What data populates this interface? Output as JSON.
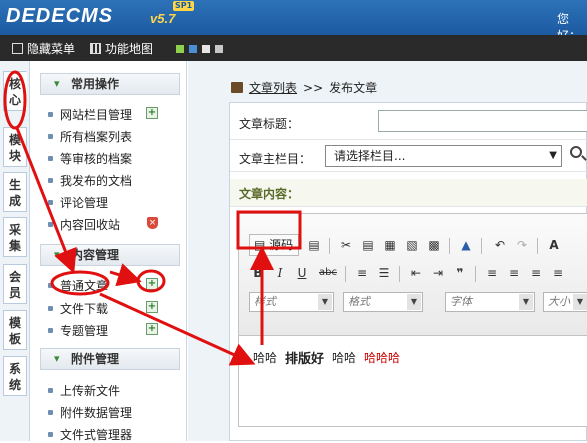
{
  "header": {
    "logo": "DEDECMS",
    "version": "v5.7",
    "version_tag": "SP1",
    "greeting": "您好："
  },
  "menubar": {
    "hide_menu": "隐藏菜单",
    "function_map": "功能地图",
    "skin_colors": [
      "#8fd14f",
      "#4a8fd6",
      "#e6e6e6",
      "#d8d8d8"
    ]
  },
  "left_tabs": [
    "核心",
    "模块",
    "生成",
    "采集",
    "会员",
    "模板",
    "系统"
  ],
  "sidebar": {
    "sections": [
      {
        "title": "常用操作",
        "items": [
          "网站栏目管理",
          "所有档案列表",
          "等审核的档案",
          "我发布的文档",
          "评论管理",
          "内容回收站"
        ]
      },
      {
        "title": "内容管理",
        "items": [
          "普通文章",
          "文件下载",
          "专题管理"
        ]
      },
      {
        "title": "附件管理",
        "items": [
          "上传新文件",
          "附件数据管理",
          "文件式管理器"
        ]
      }
    ]
  },
  "breadcrumb": {
    "link": "文章列表",
    "separator": ">>",
    "current": "发布文章"
  },
  "form": {
    "title_label": "文章标题：",
    "column_label": "文章主栏目：",
    "column_select": "请选择栏目...",
    "content_label": "文章内容："
  },
  "editor": {
    "source_button": "源码",
    "toolbar_row1": [
      "✂",
      "▤",
      "▦",
      "▧",
      "▩",
      "▲",
      "↶",
      "↷",
      "A"
    ],
    "toolbar_row2": [
      "B",
      "I",
      "U",
      "abc",
      "≡",
      "☰",
      "⇤",
      "⇥",
      "❞",
      "≡",
      "≡",
      "≡",
      "≡"
    ],
    "combo_style": "样式",
    "combo_format": "格式",
    "combo_font": "字体",
    "combo_size": "大小",
    "body": {
      "text1": "哈哈",
      "text2": "排版好",
      "text3": "哈哈",
      "text4": "哈哈哈"
    }
  }
}
